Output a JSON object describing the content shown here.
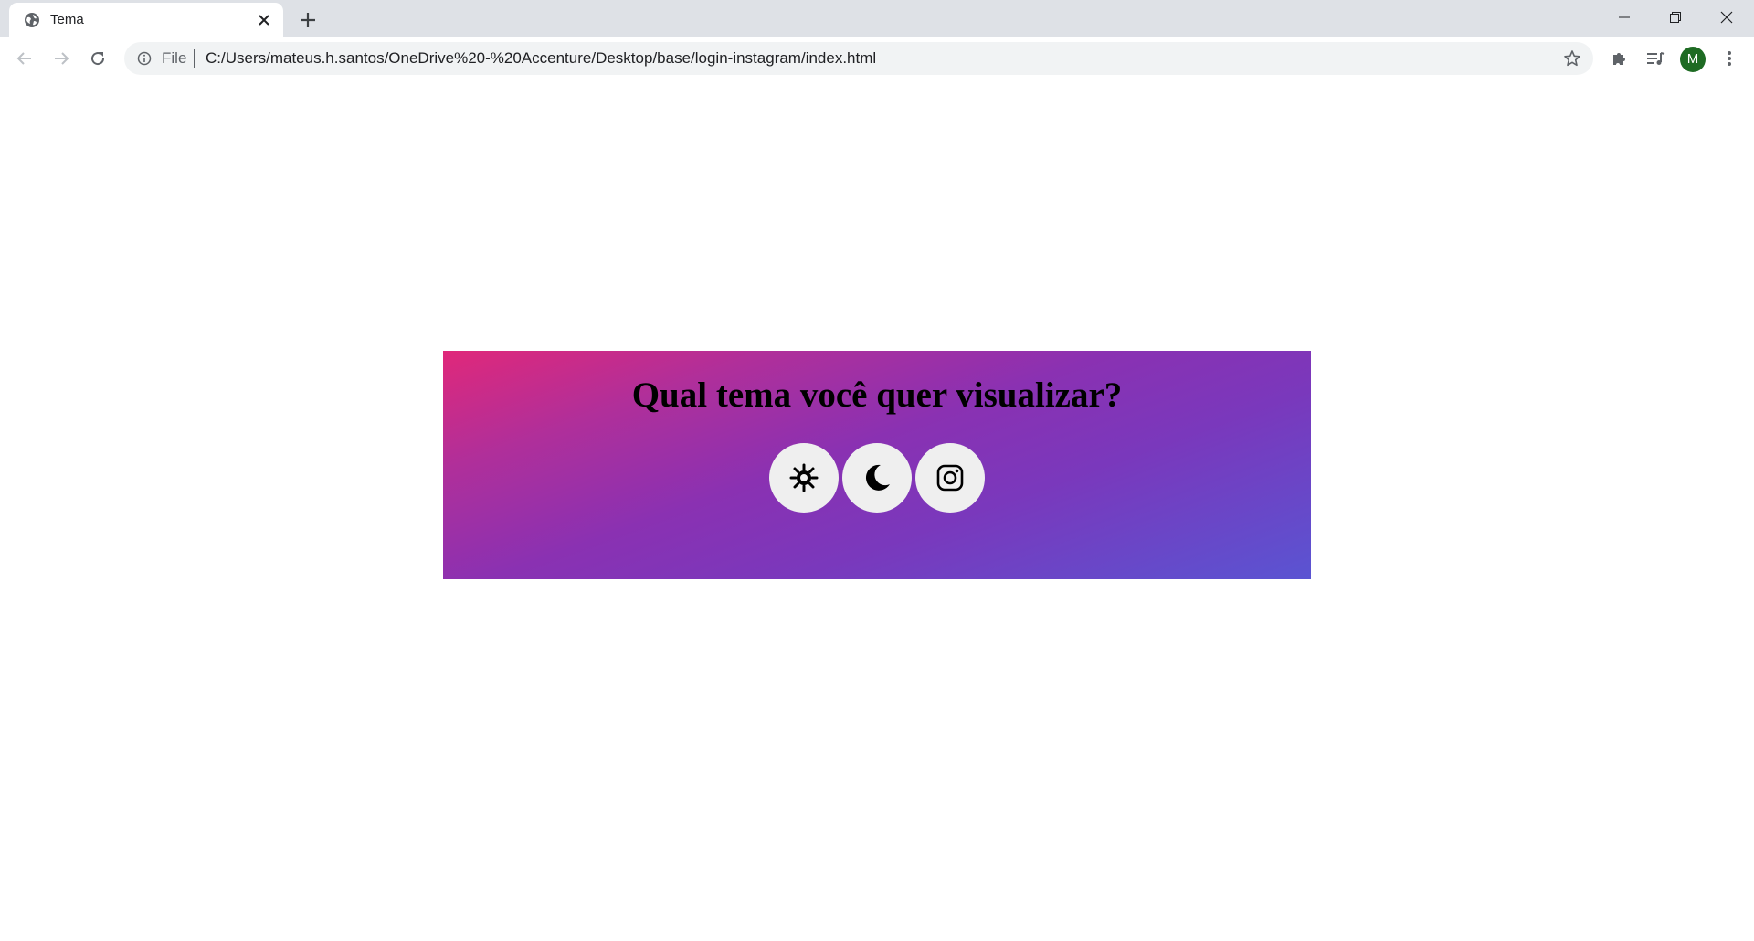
{
  "browser": {
    "tab": {
      "title": "Tema"
    },
    "address_bar": {
      "scheme_label": "File",
      "url": "C:/Users/mateus.h.santos/OneDrive%20-%20Accenture/Desktop/base/login-instagram/index.html"
    },
    "profile": {
      "initial": "M",
      "color": "#1e6b23"
    },
    "icons": {
      "favicon": "globe-icon",
      "tab_close": "close-icon",
      "new_tab": "plus-icon",
      "back": "arrow-left-icon",
      "forward": "arrow-right-icon",
      "reload": "reload-icon",
      "site_info": "info-icon",
      "bookmark": "star-icon",
      "extensions": "puzzle-icon",
      "media": "media-control-icon",
      "menu": "kebab-menu-icon",
      "minimize": "minimize-icon",
      "maximize": "restore-icon",
      "close_window": "close-icon"
    }
  },
  "page": {
    "question": "Qual tema você quer visualizar?",
    "panel_gradient": [
      "#e0287a",
      "#8a31b2",
      "#5a54d2"
    ],
    "theme_buttons": [
      {
        "id": "light",
        "icon": "sun-icon"
      },
      {
        "id": "dark",
        "icon": "moon-icon"
      },
      {
        "id": "instagram",
        "icon": "instagram-icon"
      }
    ]
  }
}
